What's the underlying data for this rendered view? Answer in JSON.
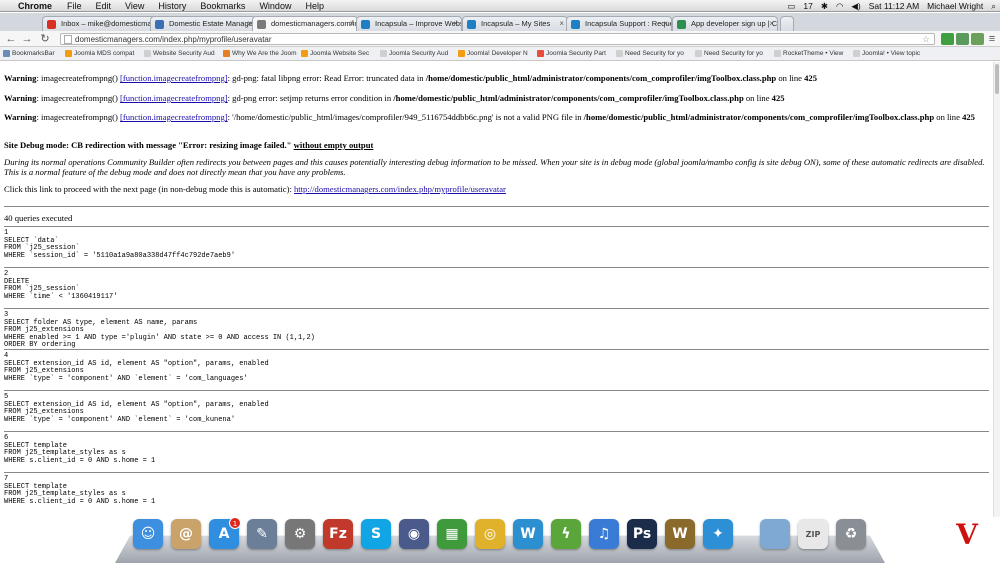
{
  "menubar": {
    "app_name": "Chrome",
    "menus": [
      "File",
      "Edit",
      "View",
      "History",
      "Bookmarks",
      "Window",
      "Help"
    ],
    "status": {
      "battery": "17",
      "datetime": "Sat 11:12 AM",
      "user": "Michael Wright"
    }
  },
  "tabs": [
    {
      "label": "Inbox – mike@domesticmar",
      "color": "#d93025"
    },
    {
      "label": "Domestic Estate Managers A",
      "color": "#3b6fb6"
    },
    {
      "label": "domesticmanagers.com/ind",
      "color": "#7a7a7a"
    },
    {
      "label": "Incapsula – Improve Website",
      "color": "#1e7fc4"
    },
    {
      "label": "Incapsula – My Sites",
      "color": "#1e7fc4"
    },
    {
      "label": "Incapsula Support : Request",
      "color": "#1e7fc4"
    },
    {
      "label": "App developer sign up | Clo",
      "color": "#2d8f4e"
    }
  ],
  "address": {
    "url": "domesticmanagers.com/index.php/myprofile/useravatar"
  },
  "bookmarks": [
    {
      "label": "BookmarksBar",
      "color": "#6b8bb9"
    },
    {
      "label": "Joomla MDS compat",
      "color": "#f39c12"
    },
    {
      "label": "Website Security Aud",
      "color": "#cfcfcf"
    },
    {
      "label": "Why We Are the Joom",
      "color": "#e67e22"
    },
    {
      "label": "Joomla Website Sec",
      "color": "#f39c12"
    },
    {
      "label": "Joomla Security Aud",
      "color": "#cfcfcf"
    },
    {
      "label": "Joomla! Developer N",
      "color": "#f39c12"
    },
    {
      "label": "Joomla Security Part",
      "color": "#e74c3c"
    },
    {
      "label": "Need Security for yo",
      "color": "#cfcfcf"
    },
    {
      "label": "Need Security for yo",
      "color": "#cfcfcf"
    },
    {
      "label": "RocketTheme • View",
      "color": "#cfcfcf"
    },
    {
      "label": "Joomla! • View topic",
      "color": "#cfcfcf"
    }
  ],
  "warnings": [
    {
      "label": "Warning",
      "fn": "imagecreatefrompng()",
      "link": "[function.imagecreatefrompng]",
      "msg": ": gd-png: fatal libpng error: Read Error: truncated data in ",
      "file": "/home/domestic/public_html/administrator/components/com_comprofiler/imgToolbox.class.php",
      "online": " on line ",
      "line": "425"
    },
    {
      "label": "Warning",
      "fn": "imagecreatefrompng()",
      "link": "[function.imagecreatefrompng]",
      "msg": ": gd-png error: setjmp returns error condition in ",
      "file": "/home/domestic/public_html/administrator/components/com_comprofiler/imgToolbox.class.php",
      "online": " on line ",
      "line": "425"
    },
    {
      "label": "Warning",
      "fn": "imagecreatefrompng()",
      "link": "[function.imagecreatefrompng]",
      "msg": ": '/home/domestic/public_html/images/comprofiler/949_5116754ddbb6c.png' is not a valid PNG file in ",
      "file": "/home/domestic/public_html/administrator/components/com_comprofiler/imgToolbox.class.php",
      "online": " on line ",
      "line": "425"
    }
  ],
  "debug": {
    "heading": "Site Debug mode: CB redirection with message \"Error: resizing image failed.\"",
    "heading_link": "without empty output",
    "note": "During its normal operations Community Builder often redirects you between pages and this causes potentially interesting debug information to be missed. When your site is in debug mode (global joomla/mambo config is site debug ON), some of these automatic redirects are disabled. This is a normal feature of the debug mode and does not directly mean that you have any problems.",
    "proceed_text": "Click this link to proceed with the next page (in non-debug mode this is automatic): ",
    "proceed_link": "http://domesticmanagers.com/index.php/myprofile/useravatar"
  },
  "queries_count": "40 queries executed",
  "queries": [
    "1\nSELECT `data`\nFROM `j25_session`\nWHERE `session_id` = '5110a1a9a80a338d47ff4c792de7aeb9'",
    "2\nDELETE\nFROM `j25_session`\nWHERE `time` < '1360419117'",
    "3\nSELECT folder AS type, element AS name, params\nFROM j25_extensions\nWHERE enabled >= 1 AND type ='plugin' AND state >= 0 AND access IN (1,1,2)\nORDER BY ordering",
    "4\nSELECT extension_id AS id, element AS \"option\", params, enabled\nFROM j25_extensions\nWHERE `type` = 'component' AND `element` = 'com_languages'",
    "5\nSELECT extension_id AS id, element AS \"option\", params, enabled\nFROM j25_extensions\nWHERE `type` = 'component' AND `element` = 'com_kunena'",
    "6\nSELECT template\nFROM j25_template_styles as s\nWHERE s.client_id = 0 AND s.home = 1",
    "7\nSELECT template\nFROM j25_template_styles as s\nWHERE s.client_id = 0 AND s.home = 1"
  ],
  "dock": [
    {
      "name": "finder",
      "glyph": "☺",
      "color": "#3d8fe0"
    },
    {
      "name": "address-book",
      "glyph": "@",
      "color": "#c9a36a"
    },
    {
      "name": "app-store",
      "glyph": "A",
      "color": "#2f8ee0"
    },
    {
      "name": "preview",
      "glyph": "✎",
      "color": "#6b7f99"
    },
    {
      "name": "system-preferences",
      "glyph": "⚙",
      "color": "#777"
    },
    {
      "name": "filezilla",
      "glyph": "Fz",
      "color": "#c0392b"
    },
    {
      "name": "skype",
      "glyph": "S",
      "color": "#12a5e6"
    },
    {
      "name": "quicktime",
      "glyph": "◉",
      "color": "#4a5a8a"
    },
    {
      "name": "numbers",
      "glyph": "▦",
      "color": "#3e9a3a"
    },
    {
      "name": "chrome",
      "glyph": "◎",
      "color": "#e0b12a"
    },
    {
      "name": "wordpress",
      "glyph": "W",
      "color": "#2c8fcf"
    },
    {
      "name": "network",
      "glyph": "ϟ",
      "color": "#5aa63a"
    },
    {
      "name": "itunes",
      "glyph": "♫",
      "color": "#3a7bd5"
    },
    {
      "name": "photoshop",
      "glyph": "Ps",
      "color": "#1b2c4a"
    },
    {
      "name": "world-of-warcraft",
      "glyph": "W",
      "color": "#8a6a2a"
    },
    {
      "name": "safari",
      "glyph": "✦",
      "color": "#2d8fd6"
    },
    {
      "name": "folder",
      "glyph": "",
      "color": "#7fa8d2"
    },
    {
      "name": "zip-archive",
      "glyph": "ZIP",
      "color": "#e8e8e8"
    },
    {
      "name": "trash",
      "glyph": "♻",
      "color": "#8a8f96"
    }
  ],
  "dock_badge": "1"
}
